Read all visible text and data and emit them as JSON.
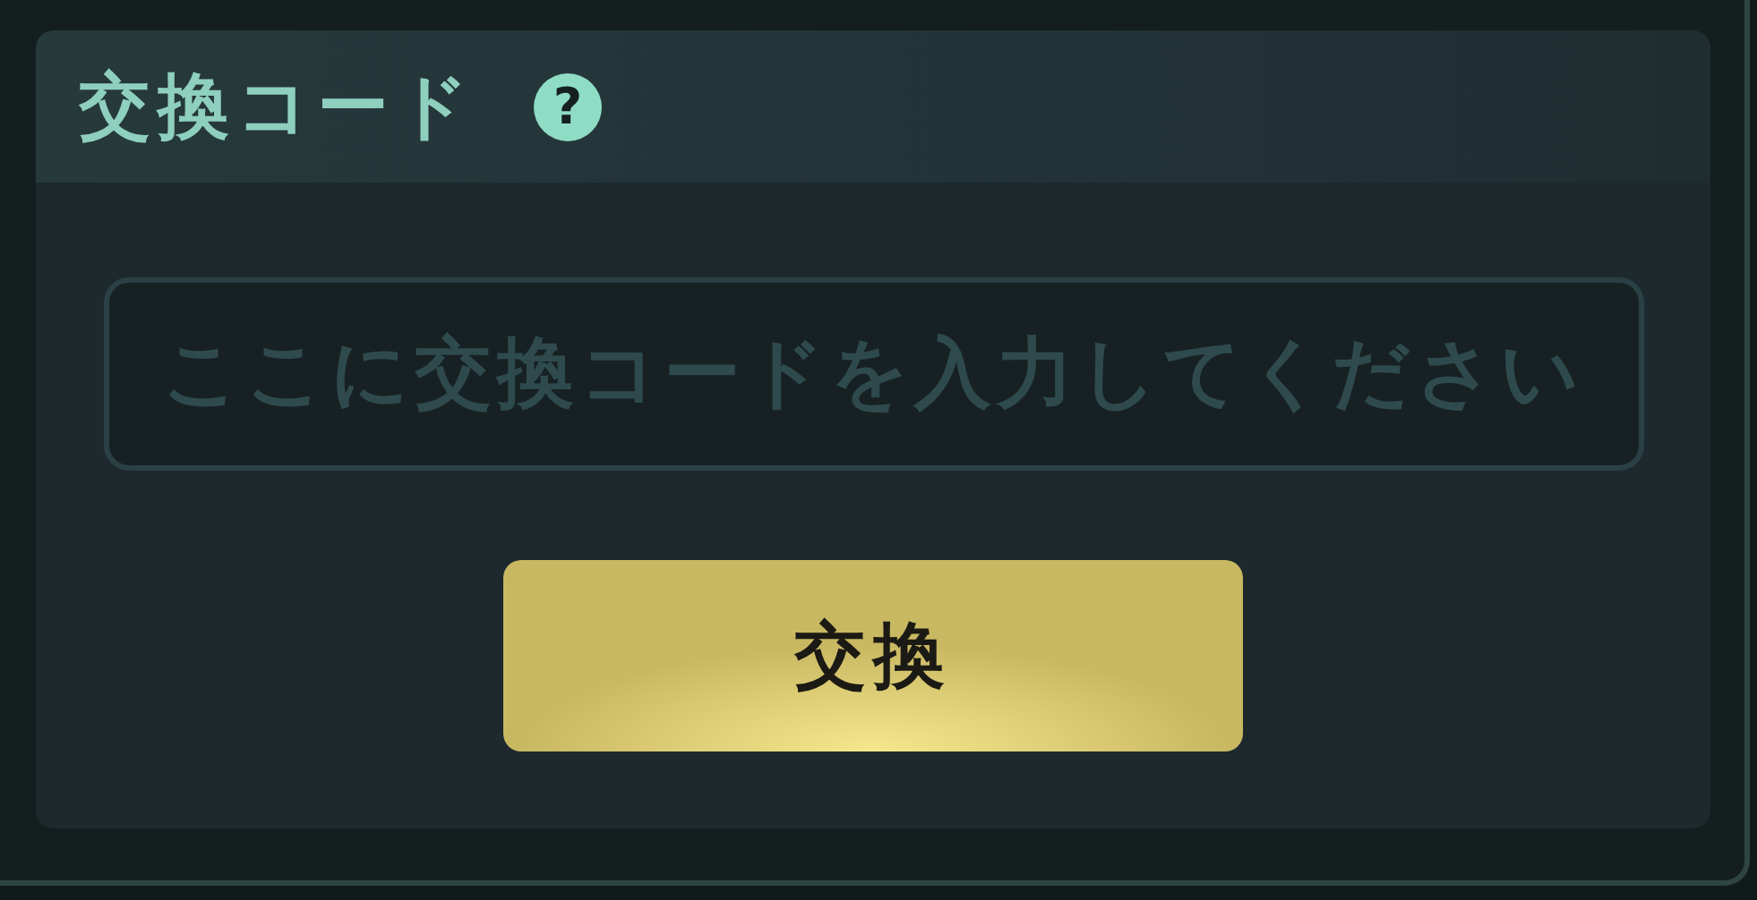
{
  "panel": {
    "title": "交換コード",
    "help_icon": "?"
  },
  "code_field": {
    "placeholder": "ここに交換コードを入力してください"
  },
  "redeem_button": {
    "label": "交換"
  }
}
